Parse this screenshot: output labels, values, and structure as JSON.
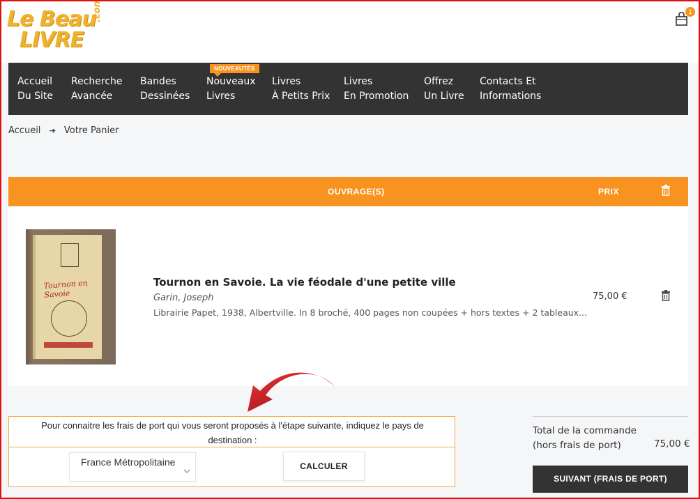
{
  "header": {
    "logo": {
      "line1": "Le Beau",
      "line2": "LIVRE",
      "suffix": ".com"
    },
    "cart_count": "1"
  },
  "nav": {
    "items": [
      {
        "line1": "Accueil",
        "line2": "Du Site"
      },
      {
        "line1": "Recherche",
        "line2": "Avancée"
      },
      {
        "line1": "Bandes",
        "line2": "Dessinées"
      },
      {
        "line1": "Nouveaux",
        "line2": "Livres"
      },
      {
        "line1": "Livres",
        "line2": "À Petits Prix"
      },
      {
        "line1": "Livres",
        "line2": "En Promotion"
      },
      {
        "line1": "Offrez",
        "line2": "Un Livre"
      },
      {
        "line1": "Contacts Et",
        "line2": "Informations"
      }
    ],
    "new_badge": "NOUVEAUTÉS"
  },
  "breadcrumb": {
    "home": "Accueil",
    "current": "Votre Panier"
  },
  "cart_table": {
    "col_works": "OUVRAGE(S)",
    "col_price": "PRIX",
    "items": [
      {
        "title": "Tournon en Savoie. La vie féodale d'une petite ville",
        "author": "Garin, Joseph",
        "description": "Librairie Papet, 1938, Albertville. In 8 broché, 400 pages non coupées + hors textes + 2 tableaux...",
        "price": "75,00 €"
      }
    ]
  },
  "shipping": {
    "prompt": "Pour connaitre les frais de port qui vous seront proposés à l'étape suivante, indiquez le pays de destination :",
    "country": "France Métropolitaine",
    "calc_button": "CALCULER"
  },
  "summary": {
    "total_label_line1": "Total de la commande",
    "total_label_line2": "(hors frais de port)",
    "total_value": "75,00 €",
    "next_button": "SUIVANT (FRAIS DE PORT)"
  },
  "colors": {
    "accent": "#f7931e",
    "nav_bg": "#333333",
    "annotation_frame": "#e01010",
    "arrow": "#c0151a"
  }
}
